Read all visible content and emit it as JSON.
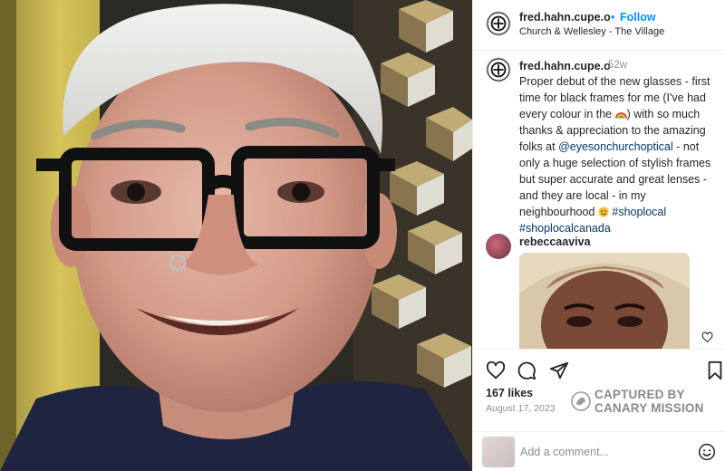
{
  "post": {
    "username": "fred.hahn.cupe.o",
    "follow_separator": "•",
    "follow_label": "Follow",
    "location": "Church & Wellesley - The Village"
  },
  "caption": {
    "username": "fred.hahn.cupe.o",
    "time_ago": "52w",
    "text_part1": "Proper debut of the new glasses - first time for black frames for me (I've had every colour in the ",
    "text_part2": ") with so much thanks & appreciation to the amazing folks at ",
    "mention": "@eyesonchurchoptical",
    "text_part3": " - not only a huge selection of stylish frames but super accurate and great lenses - and they are local - in my neighbourhood ",
    "hashtag1": "#shoplocal",
    "hashtag2": "#shoplocalcanada"
  },
  "comment2": {
    "username": "rebeccaaviva"
  },
  "engagement": {
    "likes": "167 likes",
    "date": "August 17, 2023"
  },
  "watermark": {
    "line1": "CAPTURED BY",
    "line2": "CANARY MISSION"
  },
  "add_comment": {
    "placeholder": "Add a comment..."
  },
  "icons": {
    "like": "heart-icon",
    "comment": "comment-icon",
    "share": "share-icon",
    "save": "bookmark-icon",
    "emoji": "emoji-icon",
    "comment_like": "heart-icon"
  },
  "colors": {
    "link": "#00376b",
    "follow": "#0095f6",
    "muted": "#8e8e8e"
  }
}
